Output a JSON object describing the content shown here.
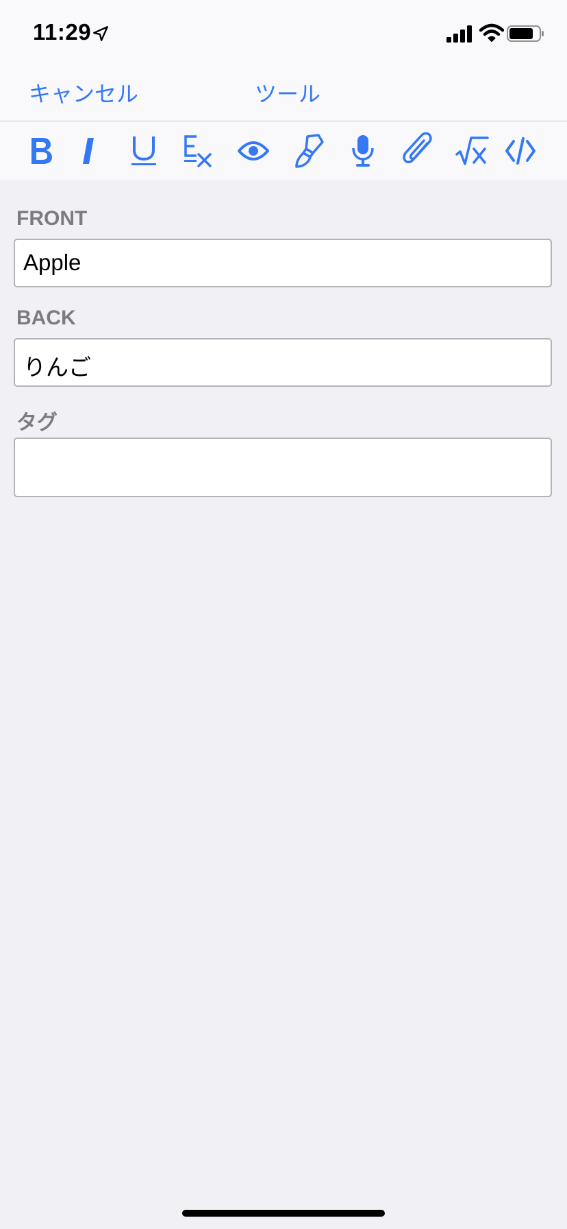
{
  "status_bar": {
    "time": "11:29",
    "icons": [
      "location-arrow-icon",
      "cellular-signal-icon",
      "wifi-icon",
      "battery-icon"
    ]
  },
  "nav": {
    "cancel_label": "キャンセル",
    "tools_label": "ツール"
  },
  "toolbar": {
    "tools": [
      "bold",
      "italic",
      "underline",
      "clear-formatting",
      "eye",
      "paintbrush",
      "microphone",
      "paperclip",
      "math-root",
      "code"
    ]
  },
  "fields": {
    "front": {
      "label": "FRONT",
      "value": "Apple"
    },
    "back": {
      "label": "BACK",
      "value": "りんご"
    },
    "tags": {
      "label": "タグ",
      "value": ""
    }
  },
  "colors": {
    "accent": "#3478f6",
    "background": "#f0f0f5",
    "label": "#7b7b80"
  }
}
